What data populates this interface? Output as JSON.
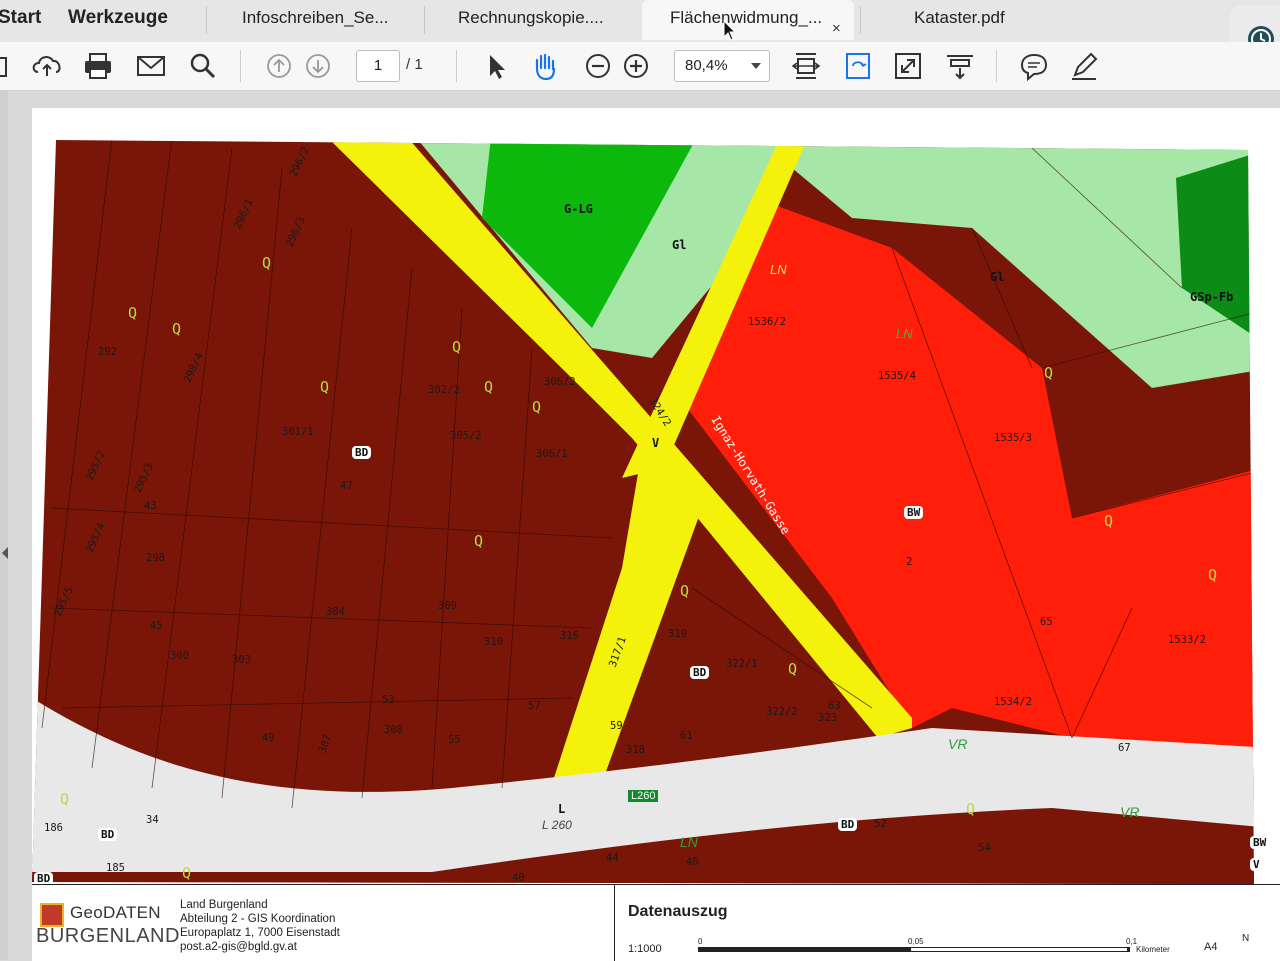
{
  "tabs": [
    {
      "label": "Start",
      "bold": true
    },
    {
      "label": "Werkzeuge",
      "bold": true
    },
    {
      "label": "Infoschreiben_Se...",
      "bold": false
    },
    {
      "label": "Rechnungskopie....",
      "bold": false
    },
    {
      "label": "Flächenwidmung_...",
      "bold": false,
      "active": true
    },
    {
      "label": "Kataster.pdf",
      "bold": false
    }
  ],
  "tab_close_glyph": "×",
  "toolbar": {
    "icons": [
      "cloud-upload-icon",
      "print-icon",
      "mail-icon",
      "search-icon",
      "page-up-icon",
      "page-down-icon",
      "select-arrow-icon",
      "hand-icon",
      "zoom-out-icon",
      "zoom-in-icon",
      "fit-page-icon",
      "rotate-icon",
      "fullscreen-icon",
      "scroll-mode-icon",
      "comment-icon",
      "pen-icon"
    ],
    "page_current": "1",
    "page_total": "/ 1",
    "zoom": "80,4%"
  },
  "colors": {
    "bauland_dark": "#7a1608",
    "bauland_red": "#ff1e0a",
    "gruenland_light": "#a6e6a6",
    "gruenland_green": "#0cb80c",
    "gruenland_dark": "#0a8c16",
    "verkehr_yellow": "#f4f20a",
    "road_grey": "#e8e8e8"
  },
  "map": {
    "zone_labels": [
      "G-LG",
      "Gl",
      "Gl",
      "GSp-Fb",
      "LN",
      "LN",
      "BW",
      "BW",
      "BD",
      "BD",
      "BD",
      "BD",
      "BD",
      "V",
      "V",
      "L",
      "VR",
      "VR",
      "LN"
    ],
    "street_name": "Ignaz-Horvath-Gasse",
    "road_badge": "L260",
    "road_code": "L 260",
    "q_marker": "Q",
    "parcels": [
      "296/2",
      "296/1",
      "296/3",
      "292",
      "298/4",
      "302/2",
      "306/2",
      "301/1",
      "305/2",
      "306/1",
      "295/2",
      "295/3",
      "47",
      "43",
      "295/4",
      "298",
      "295/5",
      "304",
      "309",
      "45",
      "310",
      "316",
      "319",
      "300",
      "303",
      "322/1",
      "53",
      "308",
      "57",
      "59",
      "63",
      "322/2",
      "323",
      "49",
      "307",
      "55",
      "61",
      "318",
      "186",
      "34",
      "185",
      "52",
      "54",
      "44",
      "46",
      "40",
      "1536/2",
      "1535/4",
      "1535/3",
      "1533/2",
      "1534/2",
      "65",
      "67",
      "2",
      "324/2",
      "317/1"
    ]
  },
  "footer": {
    "logo_top": "GeoDATEN",
    "logo_bottom": "BURGENLAND",
    "org_lines": [
      "Land Burgenland",
      "Abteilung 2 - GIS Koordination",
      "Europaplatz 1, 7000 Eisenstadt",
      "post.a2-gis@bgld.gv.at"
    ],
    "title": "Datenauszug",
    "scale": "1:1000",
    "scale_ticks": [
      "0",
      "0,05",
      "0,1"
    ],
    "scale_unit": "Kilometer",
    "paper_size": "A4",
    "north": "N"
  }
}
